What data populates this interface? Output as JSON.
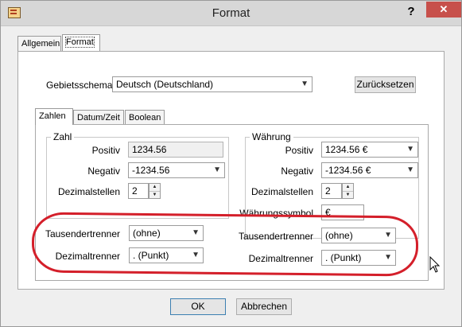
{
  "window": {
    "title": "Format",
    "help": "?",
    "close": "✕"
  },
  "outer_tabs": [
    "Allgemein",
    "Format"
  ],
  "gebietsschema": {
    "label": "Gebietsschema",
    "value": "Deutsch (Deutschland)",
    "reset": "Zurücksetzen"
  },
  "inner_tabs": [
    "Zahlen",
    "Datum/Zeit",
    "Boolean"
  ],
  "zahl": {
    "title": "Zahl",
    "positiv_label": "Positiv",
    "positiv_value": "1234.56",
    "negativ_label": "Negativ",
    "negativ_value": "-1234.56",
    "dezimal_label": "Dezimalstellen",
    "dezimal_value": "2",
    "tausend_label": "Tausendertrenner",
    "tausend_value": "(ohne)",
    "dezimaltrenner_label": "Dezimaltrenner",
    "dezimaltrenner_value": ". (Punkt)"
  },
  "waehrung": {
    "title": "Währung",
    "positiv_label": "Positiv",
    "positiv_value": "1234.56 €",
    "negativ_label": "Negativ",
    "negativ_value": "-1234.56 €",
    "dezimal_label": "Dezimalstellen",
    "dezimal_value": "2",
    "symbol_label": "Währungssymbol",
    "symbol_value": "€",
    "tausend_label": "Tausendertrenner",
    "tausend_value": "(ohne)",
    "dezimaltrenner_label": "Dezimaltrenner",
    "dezimaltrenner_value": ". (Punkt)"
  },
  "buttons": {
    "ok": "OK",
    "cancel": "Abbrechen"
  },
  "colors": {
    "highlight_ring": "#d41f2a",
    "close_button": "#c7504b"
  }
}
